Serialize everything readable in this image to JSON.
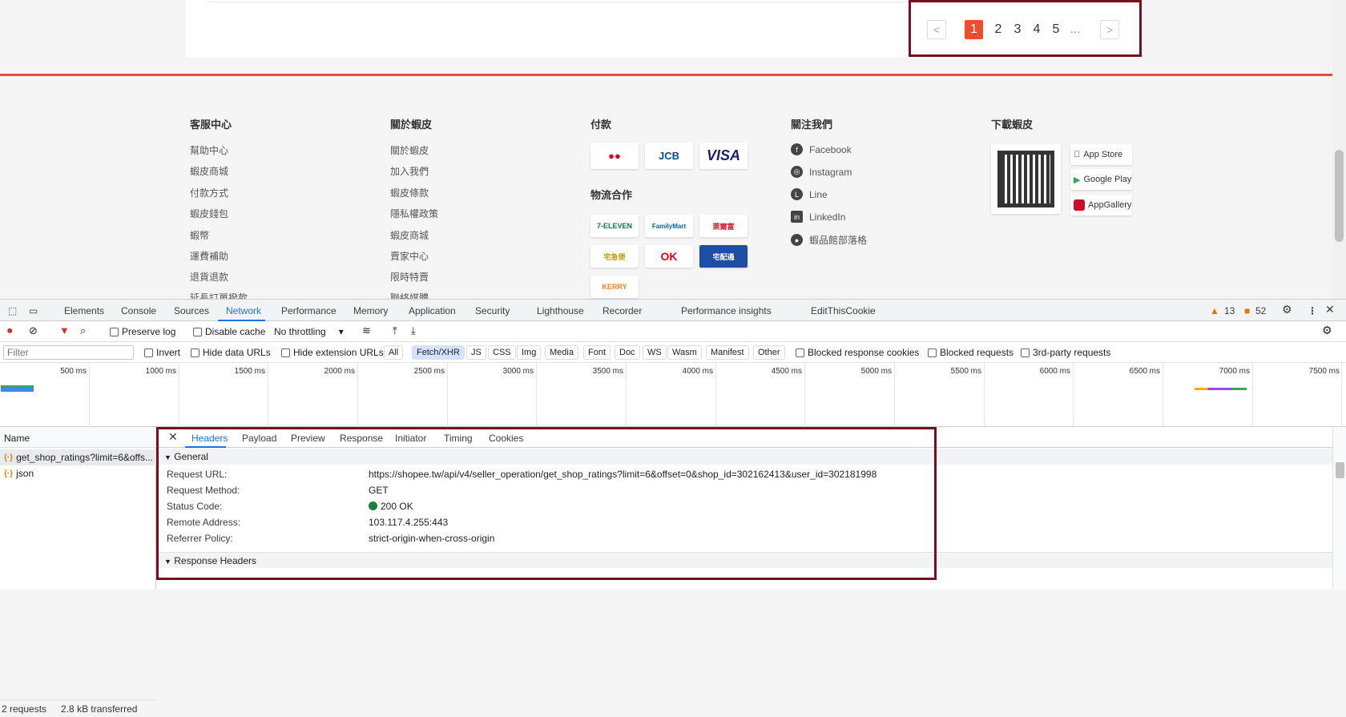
{
  "pager": {
    "prev": "<",
    "next": ">",
    "pages": [
      "1",
      "2",
      "3",
      "4",
      "5",
      "..."
    ],
    "active": "1"
  },
  "footer": {
    "col1": {
      "title": "客服中心",
      "items": [
        "幫助中心",
        "蝦皮商城",
        "付款方式",
        "蝦皮錢包",
        "蝦幣",
        "運費補助",
        "退貨退款",
        "延長訂單撥款"
      ]
    },
    "col2": {
      "title": "關於蝦皮",
      "items": [
        "關於蝦皮",
        "加入我們",
        "蝦皮條款",
        "隱私權政策",
        "蝦皮商城",
        "賣家中心",
        "限時特賣",
        "聯絡媒體"
      ]
    },
    "payment": {
      "title": "付款",
      "cards": [
        "●●",
        "JCB",
        "VISA"
      ]
    },
    "logistics": {
      "title": "物流合作",
      "carriers": [
        "7-ELEVEN",
        "FamilyMart",
        "萊爾富",
        "宅急便",
        "OK",
        "宅配通",
        "KERRY"
      ]
    },
    "follow": {
      "title": "關注我們",
      "items": [
        "Facebook",
        "Instagram",
        "Line",
        "LinkedIn",
        "蝦品館部落格"
      ]
    },
    "download": {
      "title": "下載蝦皮",
      "stores": [
        "App Store",
        "Google Play",
        "AppGallery"
      ]
    }
  },
  "devtools": {
    "tabs": [
      "Elements",
      "Console",
      "Sources",
      "Network",
      "Performance",
      "Memory",
      "Application",
      "Security",
      "Lighthouse",
      "Recorder",
      "Performance insights",
      "EditThisCookie"
    ],
    "active_tab": "Network",
    "warnings": "13",
    "issues": "52",
    "toolbar": {
      "preserve_log": "Preserve log",
      "disable_cache": "Disable cache",
      "throttling": "No throttling"
    },
    "filter": {
      "placeholder": "Filter",
      "invert": "Invert",
      "hide_data": "Hide data URLs",
      "hide_ext": "Hide extension URLs",
      "types": [
        "All",
        "Fetch/XHR",
        "JS",
        "CSS",
        "Img",
        "Media",
        "Font",
        "Doc",
        "WS",
        "Wasm",
        "Manifest",
        "Other"
      ],
      "active_type": "Fetch/XHR",
      "blocked_cookies": "Blocked response cookies",
      "blocked_requests": "Blocked requests",
      "third_party": "3rd-party requests"
    },
    "timeline_ticks": [
      "500 ms",
      "1000 ms",
      "1500 ms",
      "2000 ms",
      "2500 ms",
      "3000 ms",
      "3500 ms",
      "4000 ms",
      "4500 ms",
      "5000 ms",
      "5500 ms",
      "6000 ms",
      "6500 ms",
      "7000 ms",
      "7500 ms"
    ],
    "name_header": "Name",
    "requests": [
      "get_shop_ratings?limit=6&offs...",
      "json"
    ],
    "status": {
      "requests": "2 requests",
      "transferred": "2.8 kB transferred"
    },
    "detail_tabs": [
      "Headers",
      "Payload",
      "Preview",
      "Response",
      "Initiator",
      "Timing",
      "Cookies"
    ],
    "active_detail_tab": "Headers",
    "general_title": "General",
    "general": {
      "request_url_k": "Request URL:",
      "request_url_v": "https://shopee.tw/api/v4/seller_operation/get_shop_ratings?limit=6&offset=0&shop_id=302162413&user_id=302181998",
      "method_k": "Request Method:",
      "method_v": "GET",
      "status_k": "Status Code:",
      "status_v": "200 OK",
      "remote_k": "Remote Address:",
      "remote_v": "103.117.4.255:443",
      "referrer_k": "Referrer Policy:",
      "referrer_v": "strict-origin-when-cross-origin"
    },
    "response_headers_title": "Response Headers"
  }
}
